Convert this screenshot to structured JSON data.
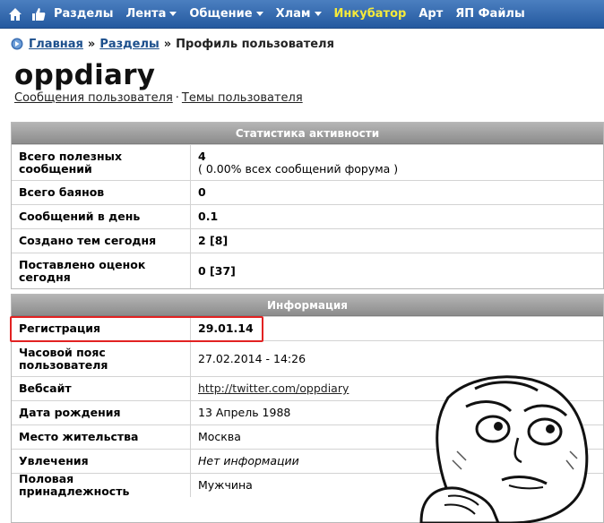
{
  "nav": {
    "items": [
      {
        "label": "Разделы",
        "dropdown": false,
        "highlight": false
      },
      {
        "label": "Лента",
        "dropdown": true,
        "highlight": false
      },
      {
        "label": "Общение",
        "dropdown": true,
        "highlight": false
      },
      {
        "label": "Хлам",
        "dropdown": true,
        "highlight": false
      },
      {
        "label": "Инкубатор",
        "dropdown": false,
        "highlight": true
      },
      {
        "label": "Арт",
        "dropdown": false,
        "highlight": false
      },
      {
        "label": "ЯП Файлы",
        "dropdown": false,
        "highlight": false
      }
    ]
  },
  "breadcrumb": {
    "home": "Главная",
    "sep1": "»",
    "sections": "Разделы",
    "sep2": "»",
    "current": "Профиль пользователя"
  },
  "user": {
    "name": "oppdiary",
    "link_messages": "Сообщения пользователя",
    "link_sep": "·",
    "link_topics": "Темы пользователя"
  },
  "stats": {
    "title": "Статистика активности",
    "rows": [
      {
        "label": "Всего полезных сообщений",
        "value": "4",
        "sub": "( 0.00% всех сообщений форума )"
      },
      {
        "label": "Всего баянов",
        "value": "0"
      },
      {
        "label": "Сообщений в день",
        "value": "0.1"
      },
      {
        "label": "Создано тем сегодня",
        "value": "2 [8]"
      },
      {
        "label": "Поставлено оценок сегодня",
        "value": "0 [37]"
      }
    ]
  },
  "info": {
    "title": "Информация",
    "rows": [
      {
        "label": "Регистрация",
        "value": "29.01.14"
      },
      {
        "label": "Часовой пояс пользователя",
        "value": "27.02.2014 - 14:26"
      },
      {
        "label": "Вебсайт",
        "value": "http://twitter.com/oppdiary"
      },
      {
        "label": "Дата рождения",
        "value": "13 Апрель 1988"
      },
      {
        "label": "Место жительства",
        "value": "Москва"
      },
      {
        "label": "Увлечения",
        "value": "Нет информации"
      },
      {
        "label": "Половая принадлежность",
        "value": "Мужчина"
      }
    ]
  },
  "colors": {
    "nav_bg": "#2f65aa",
    "highlight_nav": "#f6ea3a",
    "header_bar": "#9a9a9a",
    "highlight_border": "#e22222"
  }
}
